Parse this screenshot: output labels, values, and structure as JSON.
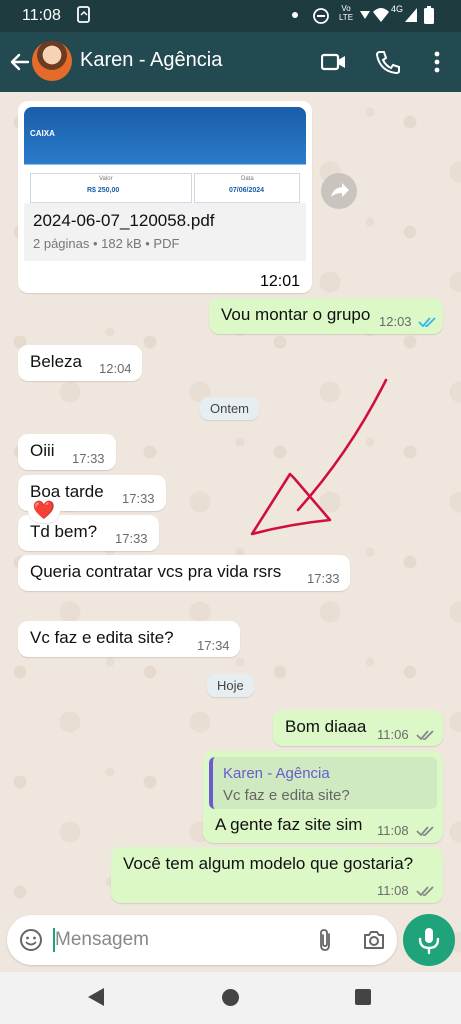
{
  "status_bar": {
    "time": "11:08",
    "network_label": "Vo LTE",
    "signal_label": "4G"
  },
  "header": {
    "contact_name": "Karen - Agência"
  },
  "messages": {
    "pdf": {
      "brand": "CAIXA",
      "value_label": "Valor",
      "value": "R$ 250,00",
      "date_label": "Data",
      "date": "07/06/2024",
      "file_name": "2024-06-07_120058.pdf",
      "file_info": "2 páginas • 182 kB • PDF",
      "time": "12:01"
    },
    "m1": {
      "text": "Vou montar o grupo",
      "time": "12:03"
    },
    "m2": {
      "text": "Beleza",
      "time": "12:04"
    },
    "date1": "Ontem",
    "m3": {
      "text": "Oiii",
      "time": "17:33"
    },
    "m4": {
      "text": "Boa tarde",
      "time": "17:33"
    },
    "m5": {
      "text": "Td bem?",
      "time": "17:33"
    },
    "m6": {
      "text": "Queria contratar vcs pra vida rsrs",
      "time": "17:33",
      "reaction": "❤️"
    },
    "m7": {
      "text": "Vc faz e edita site?",
      "time": "17:34"
    },
    "date2": "Hoje",
    "m8": {
      "text": "Bom diaaa",
      "time": "11:06"
    },
    "m9": {
      "reply_name": "Karen - Agência",
      "reply_text": "Vc faz e edita site?",
      "text": "A gente faz site sim",
      "time": "11:08"
    },
    "m10": {
      "text": "Você tem algum modelo que gostaria?",
      "time": "11:08"
    }
  },
  "composer": {
    "placeholder": "Mensagem"
  },
  "colors": {
    "header": "#244a51",
    "outgoing": "#dcf8c6",
    "incoming": "#ffffff",
    "accent": "#1fa37a",
    "read_tick": "#34b7f1",
    "annotation": "#d0103a"
  },
  "icons": [
    "back-arrow-icon",
    "video-call-icon",
    "phone-icon",
    "more-icon",
    "forward-icon",
    "emoji-icon",
    "attach-icon",
    "camera-icon",
    "mic-icon"
  ]
}
